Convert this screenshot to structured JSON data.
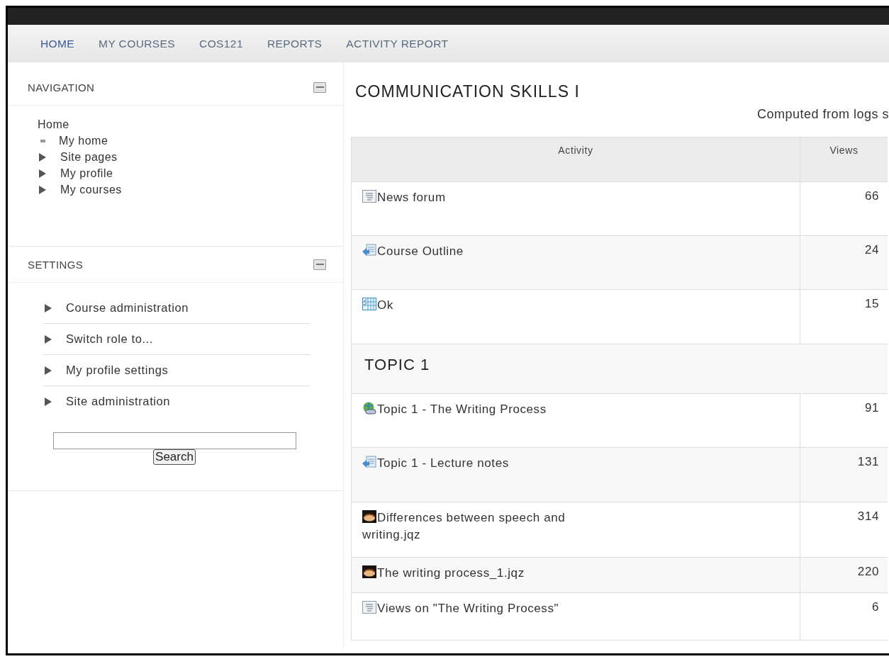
{
  "nav_bar": [
    {
      "label": "HOME",
      "selected": true
    },
    {
      "label": "MY COURSES",
      "selected": false
    },
    {
      "label": "COS121",
      "selected": false
    },
    {
      "label": "REPORTS",
      "selected": false
    },
    {
      "label": "ACTIVITY REPORT",
      "selected": false
    }
  ],
  "navigation_block": {
    "title": "NAVIGATION",
    "root": "Home",
    "items": [
      {
        "label": "My home",
        "kind": "leaf"
      },
      {
        "label": "Site pages",
        "kind": "branch"
      },
      {
        "label": "My profile",
        "kind": "branch"
      },
      {
        "label": "My courses",
        "kind": "branch"
      }
    ]
  },
  "settings_block": {
    "title": "SETTINGS",
    "items": [
      {
        "label": "Course administration",
        "kind": "branch"
      },
      {
        "label": "Switch role to...",
        "kind": "branch"
      },
      {
        "label": "My profile settings",
        "kind": "branch"
      },
      {
        "label": "Site administration",
        "kind": "branch"
      }
    ],
    "search_button": "Search"
  },
  "main": {
    "title": "COMMUNICATION SKILLS I",
    "subtitle": "Computed from logs s",
    "table": {
      "columns": [
        "Activity",
        "Views"
      ],
      "rows": [
        {
          "kind": "forum",
          "name": "News forum",
          "views": "66"
        },
        {
          "kind": "resource",
          "name": "Course Outline",
          "views": "24"
        },
        {
          "kind": "choice",
          "name": "Ok",
          "views": "15"
        },
        {
          "kind": "section",
          "name": "TOPIC 1"
        },
        {
          "kind": "url",
          "name": "Topic 1 - The Writing Process",
          "views": "91"
        },
        {
          "kind": "resource",
          "name": "Topic 1 - Lecture notes",
          "views": "131"
        },
        {
          "kind": "quiz",
          "name": "Differences between speech and writing.jqz",
          "views": "314"
        },
        {
          "kind": "quiz",
          "name": "The writing process_1.jqz",
          "views": "220"
        },
        {
          "kind": "forum",
          "name": "Views on \"The Writing Process\"",
          "views": "6"
        }
      ]
    }
  }
}
